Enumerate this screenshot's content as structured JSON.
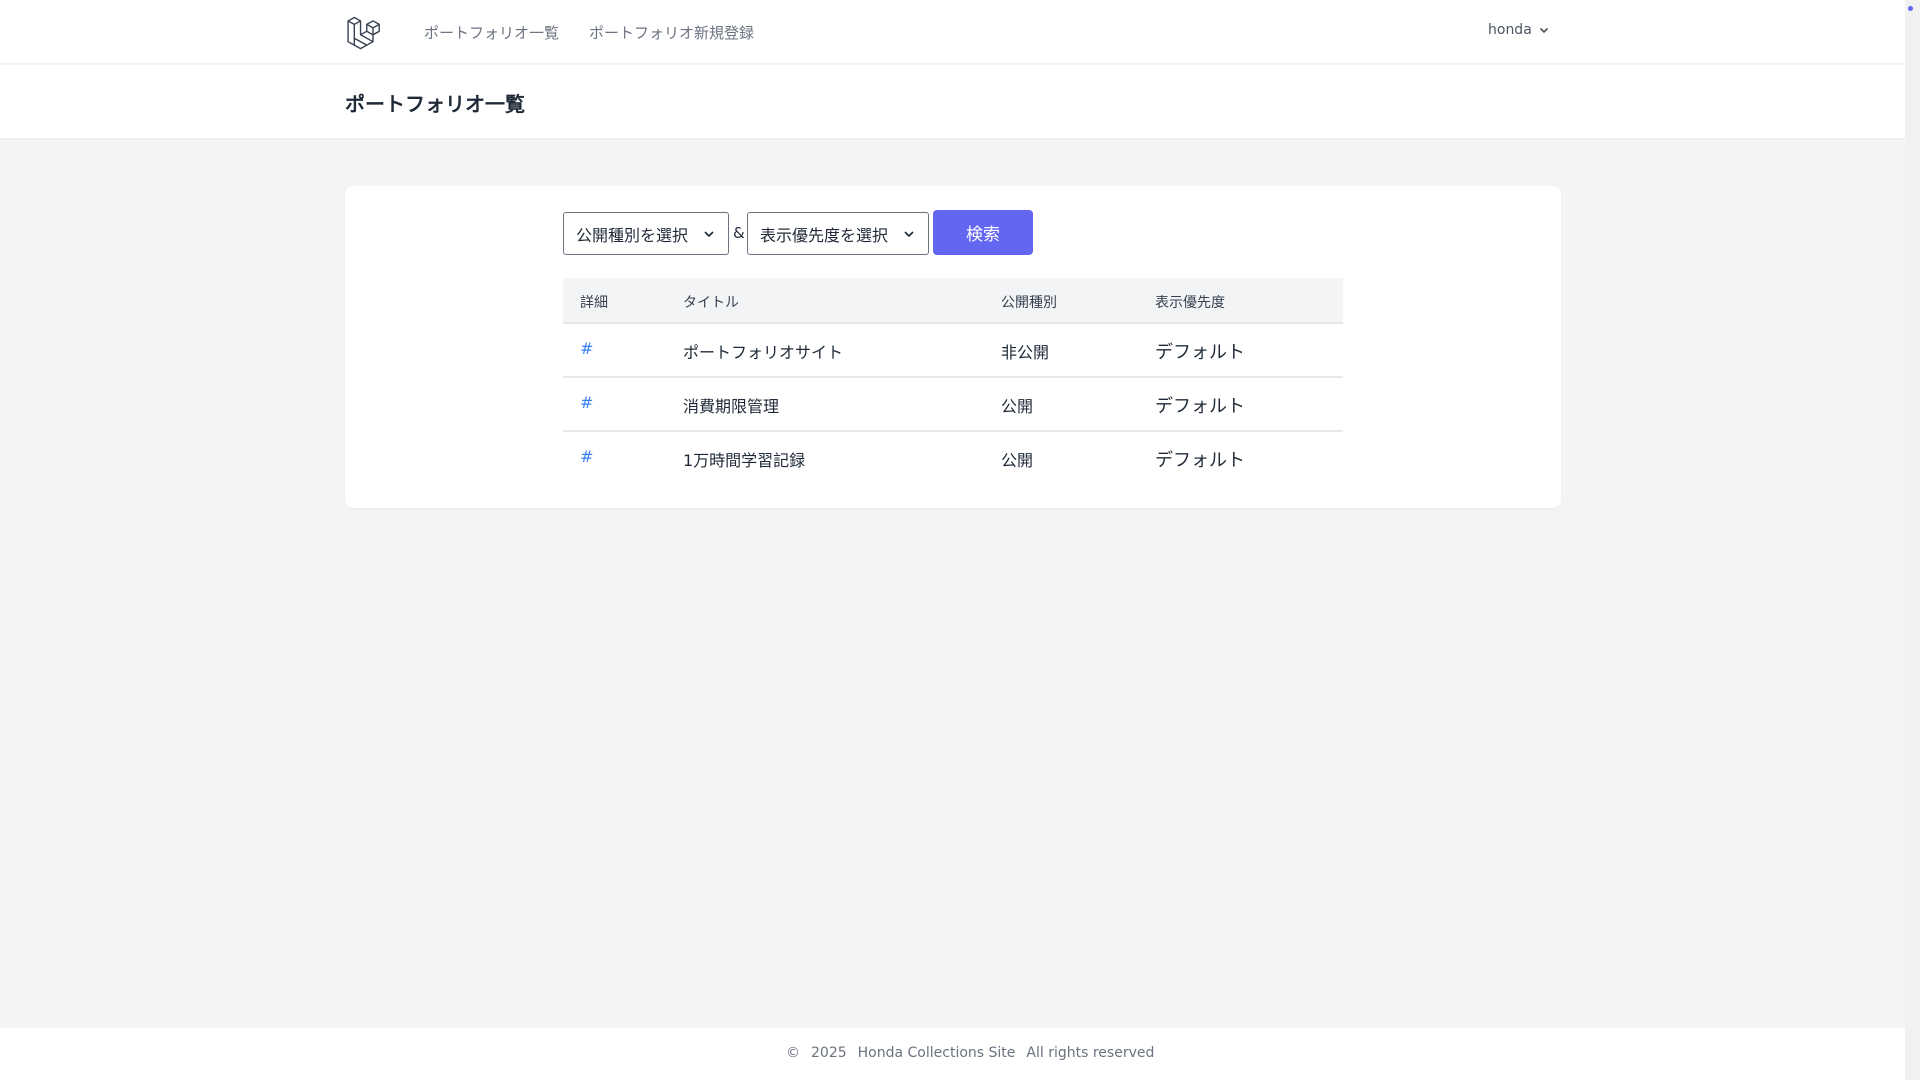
{
  "nav": {
    "logo_icon": "laravel-logo-icon",
    "links": [
      {
        "label": "ポートフォリオ一覧"
      },
      {
        "label": "ポートフォリオ新規登録"
      }
    ],
    "user": {
      "name": "honda",
      "icon": "chevron-down-icon"
    }
  },
  "header": {
    "title": "ポートフォリオ一覧"
  },
  "filters": {
    "visibility_select": {
      "selected": "公開種別を選択"
    },
    "separator": "&",
    "priority_select": {
      "selected": "表示優先度を選択"
    },
    "search_label": "検索"
  },
  "table": {
    "columns": [
      "詳細",
      "タイトル",
      "公開種別",
      "表示優先度"
    ],
    "rows": [
      {
        "link": "#",
        "title": "ポートフォリオサイト",
        "visibility": "非公開",
        "priority": "デフォルト"
      },
      {
        "link": "#",
        "title": "消費期限管理",
        "visibility": "公開",
        "priority": "デフォルト"
      },
      {
        "link": "#",
        "title": "1万時間学習記録",
        "visibility": "公開",
        "priority": "デフォルト"
      }
    ]
  },
  "footer": {
    "copyright": "©",
    "year": "2025",
    "site": "Honda Collections Site",
    "rights": "All rights reserved"
  },
  "colors": {
    "accent": "#6366f1",
    "link": "#3b82f6",
    "background": "#f3f4f6"
  }
}
